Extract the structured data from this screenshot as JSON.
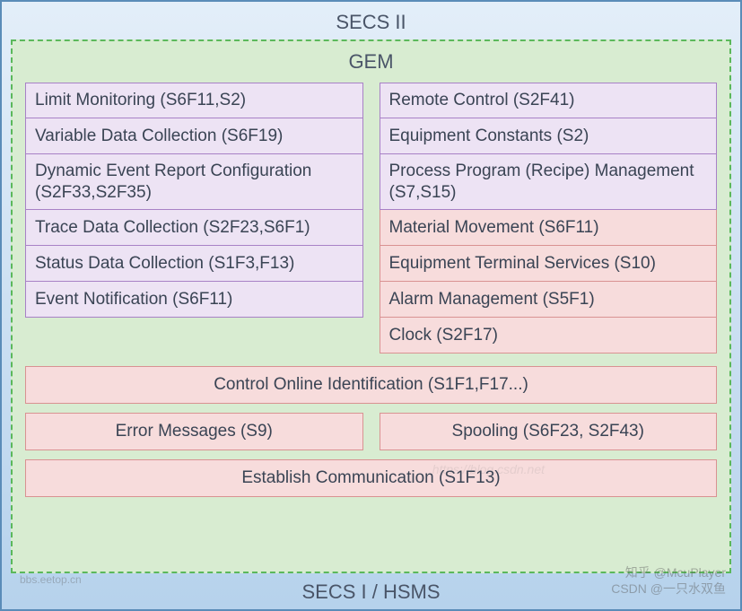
{
  "outer_title": "SECS II",
  "gem_title": "GEM",
  "footer_title": "SECS I / HSMS",
  "left_col": [
    {
      "label": "Limit Monitoring (S6F11,S2)",
      "color": "purple",
      "tall": false
    },
    {
      "label": "Variable Data Collection (S6F19)",
      "color": "purple",
      "tall": false
    },
    {
      "label": "Dynamic Event Report Configuration (S2F33,S2F35)",
      "color": "purple",
      "tall": true
    },
    {
      "label": "Trace Data Collection (S2F23,S6F1)",
      "color": "purple",
      "tall": false
    },
    {
      "label": "Status Data Collection (S1F3,F13)",
      "color": "purple",
      "tall": false
    },
    {
      "label": "Event Notification (S6F11)",
      "color": "purple",
      "tall": false
    }
  ],
  "right_col": [
    {
      "label": "Remote Control (S2F41)",
      "color": "purple",
      "tall": false
    },
    {
      "label": "Equipment Constants (S2)",
      "color": "purple",
      "tall": false
    },
    {
      "label": "Process Program (Recipe) Management (S7,S15)",
      "color": "purple",
      "tall": true
    },
    {
      "label": "Material Movement (S6F11)",
      "color": "pink",
      "tall": false
    },
    {
      "label": "Equipment Terminal Services (S10)",
      "color": "pink",
      "tall": false
    },
    {
      "label": "Alarm Management (S5F1)",
      "color": "pink",
      "tall": false
    },
    {
      "label": "Clock (S2F17)",
      "color": "pink",
      "tall": false
    }
  ],
  "bottom": {
    "row1": "Control Online Identification (S1F1,F17...)",
    "row2_left": "Error Messages (S9)",
    "row2_right": "Spooling (S6F23, S2F43)",
    "row3": "Establish Communication (S1F13)"
  },
  "watermarks": {
    "bottom_right_line1": "知乎 @McuPlayer",
    "bottom_right_line2": "CSDN @一只水双鱼",
    "bottom_left": "bbs.eetop.cn",
    "mid": "https://blog.csdn.net"
  }
}
